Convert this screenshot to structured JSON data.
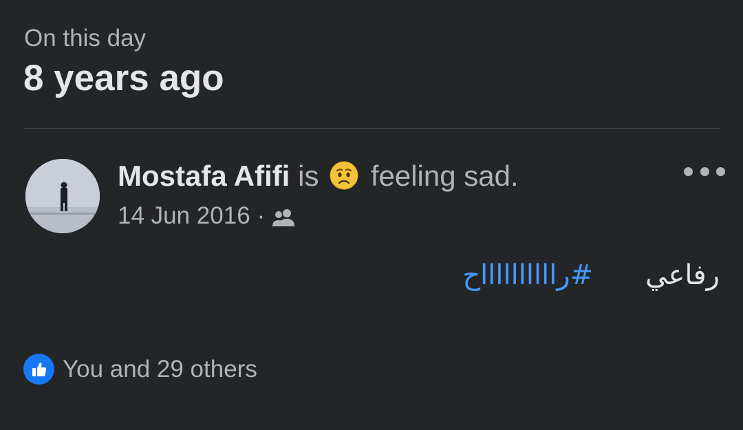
{
  "memory": {
    "eyebrow": "On this day",
    "title": "8 years ago"
  },
  "post": {
    "author": "Mostafa Afifi",
    "verb": "is",
    "feeling_icon": "sad-face-emoji",
    "feeling": "feeling sad.",
    "date": "14 Jun 2016",
    "separator": "·",
    "audience_icon": "friends-icon",
    "more_icon": "more-options-icon",
    "body_word": "رفاعي",
    "hashtag": "#رااااااااااح"
  },
  "reactions": {
    "icon": "like-icon",
    "text": "You and 29 others"
  },
  "colors": {
    "background": "#242526",
    "primary_text": "#e4e6eb",
    "secondary_text": "#b0b3b8",
    "link": "#4599ff",
    "like_blue": "#1877f2"
  }
}
